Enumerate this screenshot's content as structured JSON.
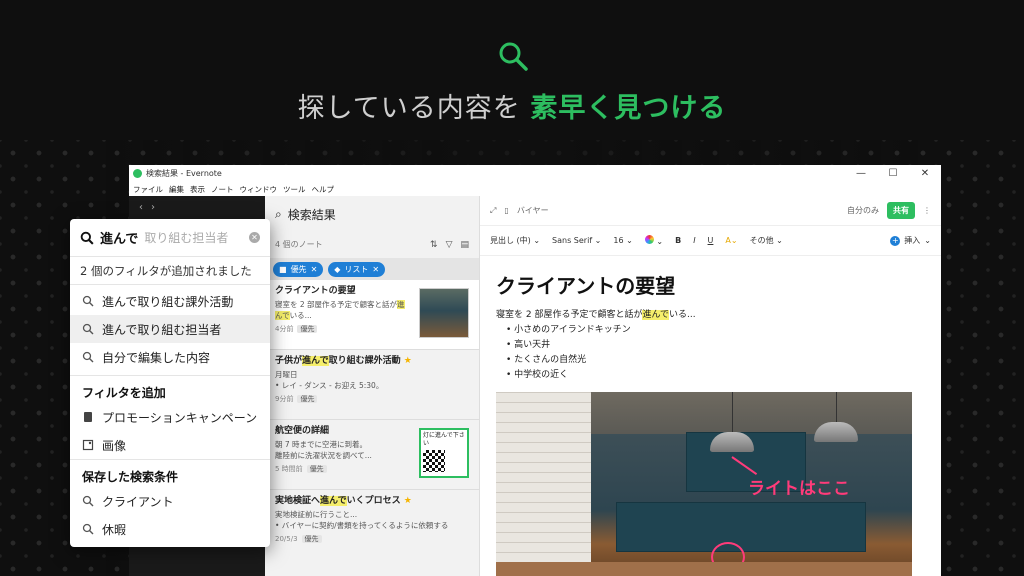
{
  "hero": {
    "headline_prefix": "探している内容を",
    "headline_highlight": "素早く見つける",
    "accent": "#2dbe60",
    "icon": "search-icon"
  },
  "window": {
    "title": "検索結果 - Evernote",
    "controls": [
      "—",
      "☐",
      "✕"
    ],
    "menu": [
      "ファイル",
      "編集",
      "表示",
      "ノート",
      "ウィンドウ",
      "ツール",
      "ヘルプ"
    ]
  },
  "note_list": {
    "title": "検索結果",
    "count": "4 個のノート",
    "chips": [
      "優先",
      "リスト"
    ],
    "notes": [
      {
        "title": "クライアントの要望",
        "line1_pre": "寝室を 2 部屋作る予定で顧客と話が",
        "line1_hl": "",
        "line2_hl": "進んで",
        "line2_post": "いる...",
        "meta": "4分前",
        "tag": "優先"
      },
      {
        "title_pre": "子供が",
        "title_hl": "進んで",
        "title_post": "取り組む課外活動",
        "line1": "月曜日",
        "line2": "• レイ - ダンス - お迎え 5:30。",
        "meta": "9分前",
        "tag": "優先"
      },
      {
        "title": "航空便の詳細",
        "line1": "朝 7 時までに空港に到着。",
        "line2": "離陸前に洗濯状況を調べて...",
        "meta": "5 時間前",
        "tag": "優先",
        "thumb_text": "灯に進んで下さい"
      },
      {
        "title_pre": "実地検証へ",
        "title_hl": "進んで",
        "title_post": "いくプロセス",
        "line1": "実地検証前に行うこと...",
        "line2": "• バイヤーに契約/書類を持ってくるように依頼する",
        "meta": "20/5/3",
        "tag": "優先"
      }
    ]
  },
  "editor": {
    "notebook": "バイヤー",
    "visibility": "自分のみ",
    "share": "共有",
    "toolbar": {
      "heading": "見出し (中)",
      "font": "Sans Serif",
      "size": "16",
      "bold": "B",
      "italic": "I",
      "underline": "U",
      "more": "その他",
      "insert": "挿入"
    },
    "doc_title": "クライアントの要望",
    "para_pre": "寝室を 2 部屋作る予定で顧客と話が",
    "para_hl": "進んで",
    "para_post": "いる...",
    "bullets": [
      "小さめのアイランドキッチン",
      "高い天井",
      "たくさんの自然光",
      "中学校の近く"
    ],
    "photo_callout": "ライトはここ",
    "callout_color": "#ff3b7a"
  },
  "search_popup": {
    "query": "進んで",
    "placeholder": "取り組む担当者",
    "filters_added": "2 個のフィルタが追加されました",
    "suggestions": [
      "進んで取り組む課外活動",
      "進んで取り組む担当者",
      "自分で編集した内容"
    ],
    "add_filter_title": "フィルタを追加",
    "filters": [
      {
        "label": "プロモーションキャンペーン",
        "icon": "notebook-icon"
      },
      {
        "label": "画像",
        "icon": "image-icon"
      }
    ],
    "saved_title": "保存した検索条件",
    "saved": [
      "クライアント",
      "休暇"
    ]
  }
}
